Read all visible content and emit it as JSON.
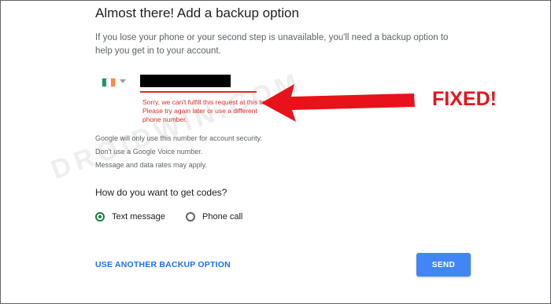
{
  "title": "Almost there! Add a backup option",
  "intro": "If you lose your phone or your second step is unavailable, you'll need a backup option to help you get in to your account.",
  "phone": {
    "country_flag_colors": [
      "#169b62",
      "#ffffff",
      "#ff883e"
    ],
    "value": ""
  },
  "error": "Sorry, we can't fulfill this request at this time. Please try again later or use a different phone number.",
  "helper": {
    "line1": "Google will only use this number for account security.",
    "line2": "Don't use a Google Voice number.",
    "line3": "Message and data rates may apply."
  },
  "codes_question": "How do you want to get codes?",
  "options": {
    "sms": "Text message",
    "call": "Phone call",
    "selected": "sms"
  },
  "actions": {
    "other": "USE ANOTHER BACKUP OPTION",
    "send": "SEND"
  },
  "annotation": {
    "text": "FIXED!",
    "color": "#e8131a"
  },
  "watermark": "DROIDWIN.COM",
  "colors": {
    "accent": "#4285f4",
    "link": "#1a73e8",
    "error": "#d93025",
    "radio_selected": "#188038"
  }
}
